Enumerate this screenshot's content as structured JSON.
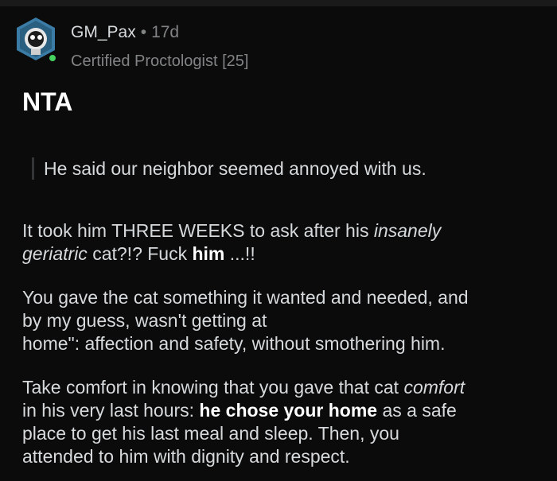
{
  "comment": {
    "author": "GM_Pax",
    "separator": "•",
    "age": "17d",
    "flair": "Certified Proctologist [25]",
    "verdict": "NTA",
    "quote": "He said our neighbor seemed annoyed with us.",
    "p1": {
      "a": "It took him THREE WEEKS to ask after his ",
      "b": "insanely",
      "c": "geriatric",
      "d": " cat?!?  Fuck ",
      "e": "him",
      "f": " ...!!"
    },
    "p2": {
      "l1": "You gave the cat something it wanted and needed, and",
      "l2": "by my guess, wasn't getting at",
      "l3": "home\": affection and safety, without smothering him."
    },
    "p3": {
      "a": "Take comfort in knowing that you gave that cat ",
      "b": "comfort",
      "c": "in his very last hours: ",
      "d": "he chose your home",
      "e": " as a safe",
      "l3": "place to get his last meal and sleep.  Then, you",
      "l4": "attended to him with dignity and respect."
    }
  },
  "icons": {
    "avatar": "astronaut-snoo-avatar-icon",
    "online": "online-status-icon"
  },
  "colors": {
    "background": "#0b0b0b",
    "text": "#d7dadc",
    "meta": "#818384",
    "online": "#46d160"
  }
}
